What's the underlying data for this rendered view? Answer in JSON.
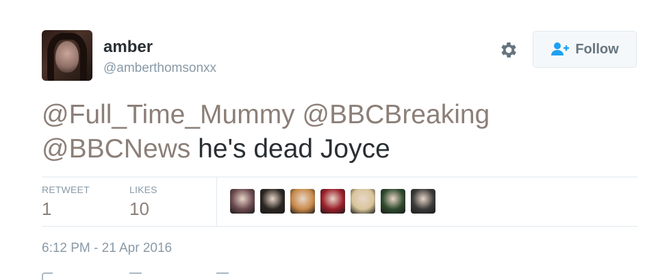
{
  "user": {
    "name": "amber",
    "handle": "@amberthomsonxx"
  },
  "follow_button": {
    "label": "Follow"
  },
  "tweet": {
    "mention1": "@Full_Time_Mummy",
    "mention2": "@BBCBreaking",
    "mention3": "@BBCNews",
    "text": "he's dead Joyce"
  },
  "stats": {
    "retweets_label": "RETWEET",
    "retweets_value": "1",
    "likes_label": "LIKES",
    "likes_value": "10"
  },
  "likers": [
    {
      "name": "liker-avatar-1",
      "color": "#6b4a4f"
    },
    {
      "name": "liker-avatar-2",
      "color": "#2b2622"
    },
    {
      "name": "liker-avatar-3",
      "color": "#c98a4a"
    },
    {
      "name": "liker-avatar-4",
      "color": "#9a1f2a"
    },
    {
      "name": "liker-avatar-5",
      "color": "#d8c59a"
    },
    {
      "name": "liker-avatar-6",
      "color": "#2f4a2e"
    },
    {
      "name": "liker-avatar-7",
      "color": "#3a3a3a"
    }
  ],
  "timestamp": "6:12 PM - 21 Apr 2016",
  "colors": {
    "text": "#292f33",
    "muted": "#8899a6",
    "mention": "#8c7f78",
    "border": "#e1e8ed"
  },
  "icons": {
    "settings": "gear-icon",
    "follow": "add-user-icon"
  }
}
